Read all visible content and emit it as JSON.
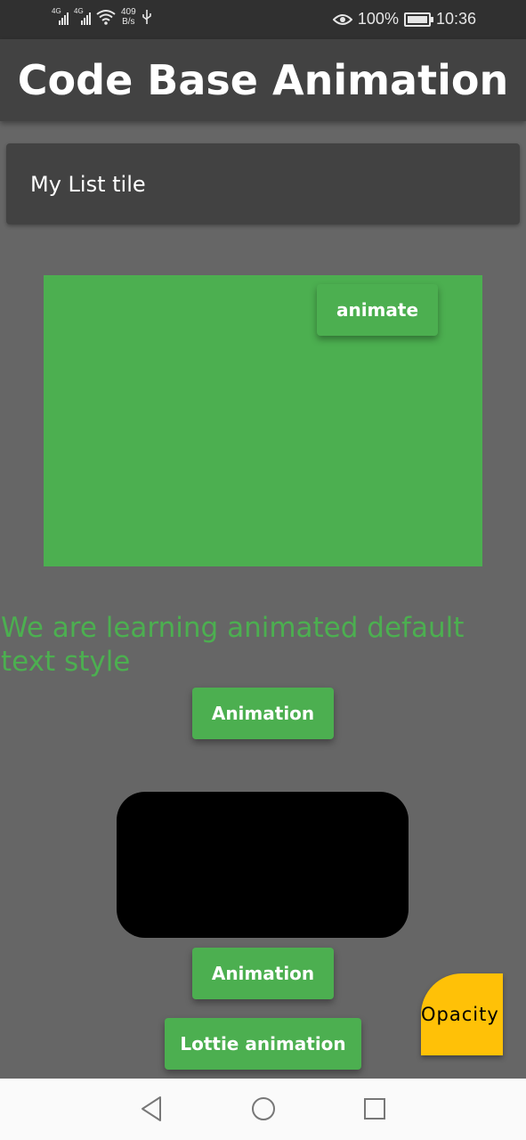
{
  "status_bar": {
    "net1": "4G",
    "net2": "4G",
    "speed_value": "409",
    "speed_unit": "B/s",
    "battery": "100%",
    "time": "10:36"
  },
  "app_bar": {
    "title": "Code Base Animation"
  },
  "list_tile": {
    "title": "My List tile"
  },
  "animated_container": {
    "button_label": "animate",
    "color": "#4CAF50"
  },
  "animated_text": {
    "text": "We are learning animated default text style",
    "color": "#4CAF50"
  },
  "buttons": {
    "animation1": "Animation",
    "animation2": "Animation",
    "lottie": "Lottie animation"
  },
  "fab": {
    "label": "Opacity",
    "color": "#FFC107"
  },
  "nav": {
    "back": "back-icon",
    "home": "home-icon",
    "recents": "recents-icon"
  }
}
